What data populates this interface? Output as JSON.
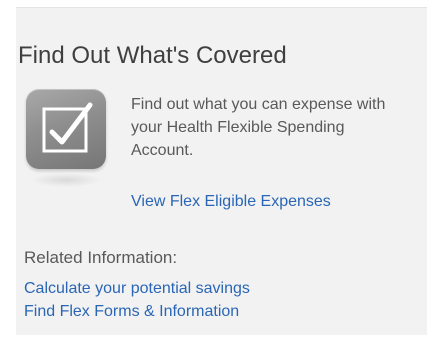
{
  "widget": {
    "title": "Find Out What's Covered",
    "icon": "checkbox-checked-icon",
    "description": "Find out what you can expense with your Health Flexible Spending Account.",
    "view_link": "View Flex Eligible Expenses"
  },
  "related": {
    "heading": "Related Information:",
    "links": [
      "Calculate your potential savings",
      "Find Flex Forms & Information"
    ]
  },
  "colors": {
    "panel_background": "#f2f2f2",
    "title_text": "#3f3f3f",
    "body_text": "#595959",
    "link": "#2a66b5",
    "icon_tile": "#8e8e8e"
  }
}
